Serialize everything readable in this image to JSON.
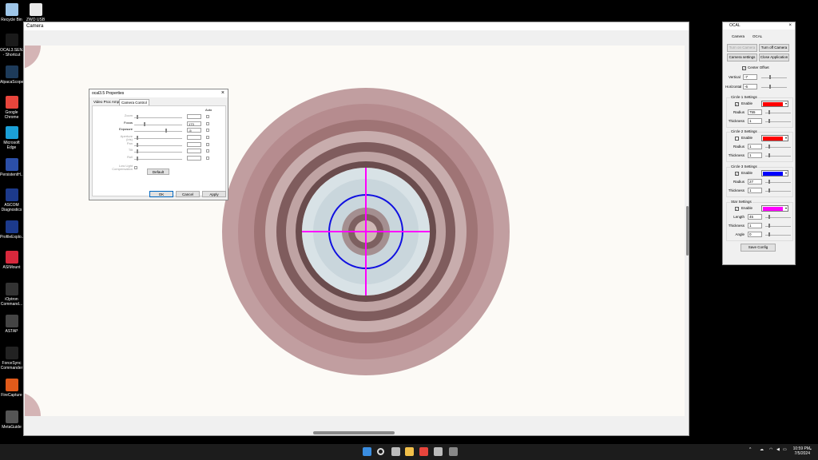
{
  "desktop": {
    "icons": [
      {
        "label": "Recycle Bin",
        "icon": "recycle-bin-icon",
        "color": "#9ec6e8"
      },
      {
        "label": "ZWO USB",
        "icon": "zwo-usb-icon",
        "color": "#e8e8e8"
      },
      {
        "label": "OCAL3.SEN...\n- Shortcut",
        "icon": "ocal-shortcut-icon",
        "color": "#1a1a1a"
      },
      {
        "label": "AlpacaScope",
        "icon": "alpacascope-icon",
        "color": "#1d3b5a"
      },
      {
        "label": "Google\nChrome",
        "icon": "chrome-icon",
        "color": "#e8453c"
      },
      {
        "label": "Microsoft\nEdge",
        "icon": "edge-icon",
        "color": "#1ba0d8"
      },
      {
        "label": "PersistentH...",
        "icon": "persistenth-icon",
        "color": "#2b4fa8"
      },
      {
        "label": "ASCOM\nDiagnostics",
        "icon": "ascom-diagnostics-icon",
        "color": "#1c3a8c"
      },
      {
        "label": "ProfileExplo...",
        "icon": "profile-explorer-icon",
        "color": "#1c3a8c"
      },
      {
        "label": "ASIMount",
        "icon": "asimount-icon",
        "color": "#d8283c"
      },
      {
        "label": "iOptron\nCommand...",
        "icon": "ioptron-icon",
        "color": "#333"
      },
      {
        "label": "ASTAP",
        "icon": "astap-icon",
        "color": "#444"
      },
      {
        "label": "ForceSync\nCommander",
        "icon": "forcesync-icon",
        "color": "#222"
      },
      {
        "label": "FireCapture",
        "icon": "firecapture-icon",
        "color": "#e05a1a"
      },
      {
        "label": "MetaGuide",
        "icon": "metaguide-icon",
        "color": "#555"
      }
    ]
  },
  "camera_window": {
    "title": "Camera"
  },
  "properties": {
    "title": "ocal3.5 Properties",
    "tabs": [
      "Video Proc Amp",
      "Camera Control"
    ],
    "auto_label": "Auto",
    "rows": [
      {
        "label": "Zoom",
        "value": "",
        "enabled": false,
        "level": 0.05
      },
      {
        "label": "Focus",
        "value": "173",
        "enabled": true,
        "level": 0.2
      },
      {
        "label": "Exposure",
        "value": "-5",
        "enabled": true,
        "level": 0.65
      },
      {
        "label": "Aperture\n(Iris)",
        "value": "",
        "enabled": false,
        "level": 0.05
      },
      {
        "label": "Pan",
        "value": "",
        "enabled": false,
        "level": 0.05
      },
      {
        "label": "Tilt",
        "value": "",
        "enabled": false,
        "level": 0.05
      },
      {
        "label": "Roll",
        "value": "",
        "enabled": false,
        "level": 0.05
      }
    ],
    "low_light": "Low Light\nCompensation",
    "default_label": "Default",
    "ok_label": "OK",
    "cancel_label": "Cancel",
    "apply_label": "Apply"
  },
  "ocal": {
    "title": "OCAL",
    "tab_camera": "Camera",
    "tab_ocal": "OCAL",
    "turn_on": "Turn on Camera",
    "turn_off": "Turn off Camera",
    "camera_settings": "Camera settings",
    "close_app": "Close Application",
    "center_offset": "Center Offset",
    "vertical_label": "Vertical",
    "vertical": "-7",
    "horizontal_label": "Horizontal",
    "horizontal": "-6",
    "circle1": {
      "title": "Circle 1 Settings",
      "enable": "Enable",
      "checked": true,
      "color": "#ff0000",
      "radius_label": "Radius",
      "radius": "755",
      "thickness_label": "Thickness",
      "thickness": "1"
    },
    "circle2": {
      "title": "Circle 2 Settings",
      "enable": "Enable",
      "checked": false,
      "color": "#ff0000",
      "radius_label": "Radius",
      "radius": "1",
      "thickness_label": "Thickness",
      "thickness": "1"
    },
    "circle3": {
      "title": "Circle 3 Settings",
      "enable": "Enable",
      "checked": true,
      "color": "#0000ff",
      "radius_label": "Radius",
      "radius": "27",
      "thickness_label": "Thickness",
      "thickness": "1"
    },
    "star": {
      "title": "Star Settings",
      "enable": "Enable",
      "checked": true,
      "color": "#ff00ff",
      "length_label": "Length",
      "length": "45",
      "thickness_label": "Thickness",
      "thickness": "1",
      "angle_label": "Angle",
      "angle": "0"
    },
    "save": "Save Config"
  },
  "taskbar": {
    "time": "10:59 PM",
    "date": "7/5/2024",
    "apps": [
      "start-icon",
      "search-icon",
      "task-view-icon",
      "file-explorer-icon",
      "chrome-icon",
      "network-app-icon",
      "camera-app-icon"
    ]
  },
  "colors": {
    "accent": "#0067c0",
    "crosshair": "#ff00ff",
    "circle": "#0000ff"
  }
}
